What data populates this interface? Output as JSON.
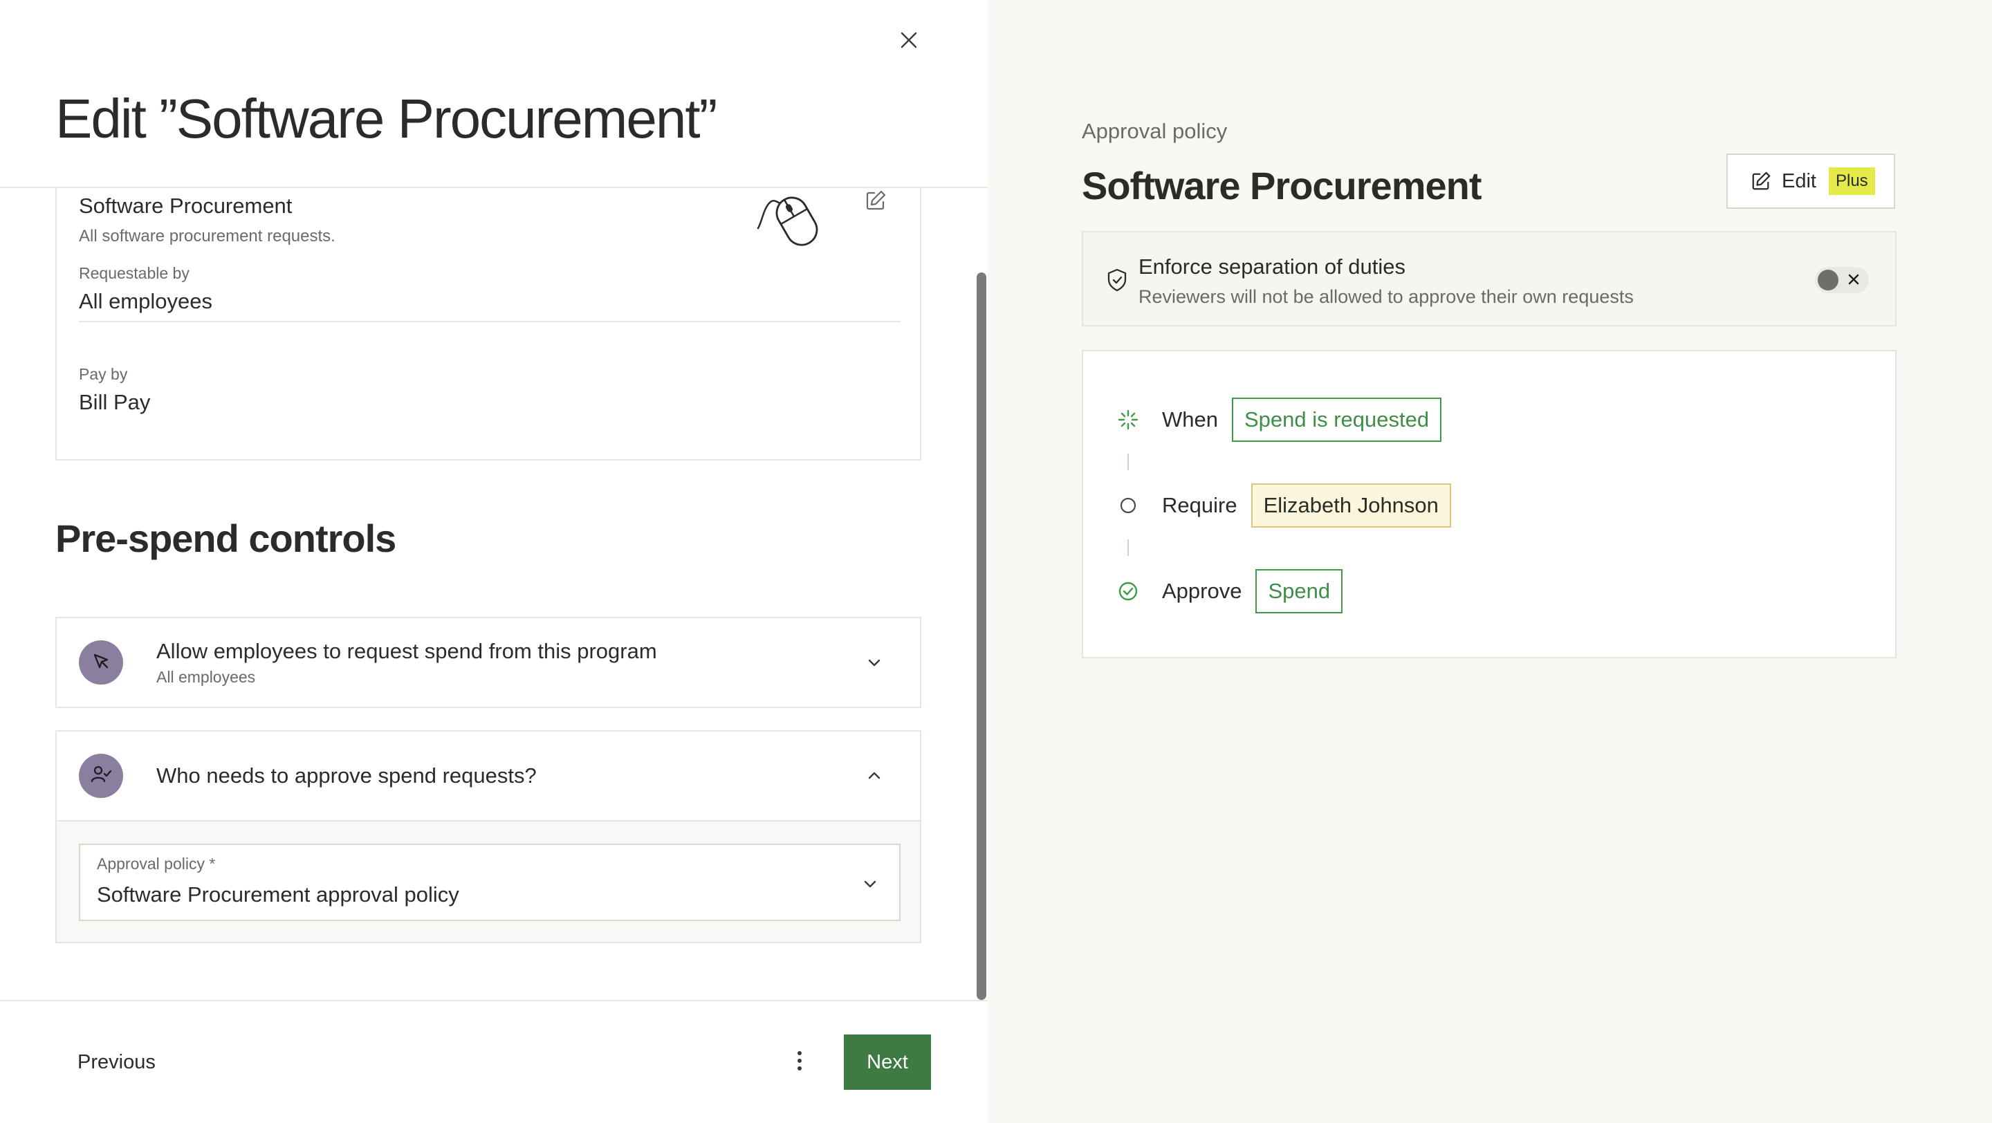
{
  "header": {
    "title": "Edit ”Software Procurement”"
  },
  "details": {
    "program_name": "Software Procurement",
    "program_description": "All software procurement requests.",
    "requestable_by_label": "Requestable by",
    "requestable_by_value": "All employees",
    "pay_by_label": "Pay by",
    "pay_by_value": "Bill Pay"
  },
  "pre_spend": {
    "section_title": "Pre-spend controls",
    "allow_request": {
      "title": "Allow employees to request spend from this program",
      "subtitle": "All employees"
    },
    "approvers": {
      "title": "Who needs to approve spend requests?",
      "select_label": "Approval policy *",
      "select_value": "Software Procurement approval policy"
    }
  },
  "footer": {
    "previous_label": "Previous",
    "next_label": "Next"
  },
  "policy_panel": {
    "eyebrow": "Approval policy",
    "title": "Software Procurement",
    "edit_label": "Edit",
    "plus_badge": "Plus",
    "separation": {
      "title": "Enforce separation of duties",
      "subtitle": "Reviewers will not be allowed to approve their own requests",
      "enabled": false
    },
    "flow": [
      {
        "verb": "When",
        "tag": "Spend is requested",
        "style": "green",
        "icon": "spinner-icon"
      },
      {
        "verb": "Require",
        "tag": "Elizabeth Johnson",
        "style": "yellow",
        "icon": "circle-icon"
      },
      {
        "verb": "Approve",
        "tag": "Spend",
        "style": "green",
        "icon": "check-circle-icon"
      }
    ]
  },
  "colors": {
    "primary_green": "#3e7a42",
    "tag_green": "#3e9a48",
    "plus_yellow": "#e3ea4a",
    "avatar_purple": "#8b7fa0"
  }
}
